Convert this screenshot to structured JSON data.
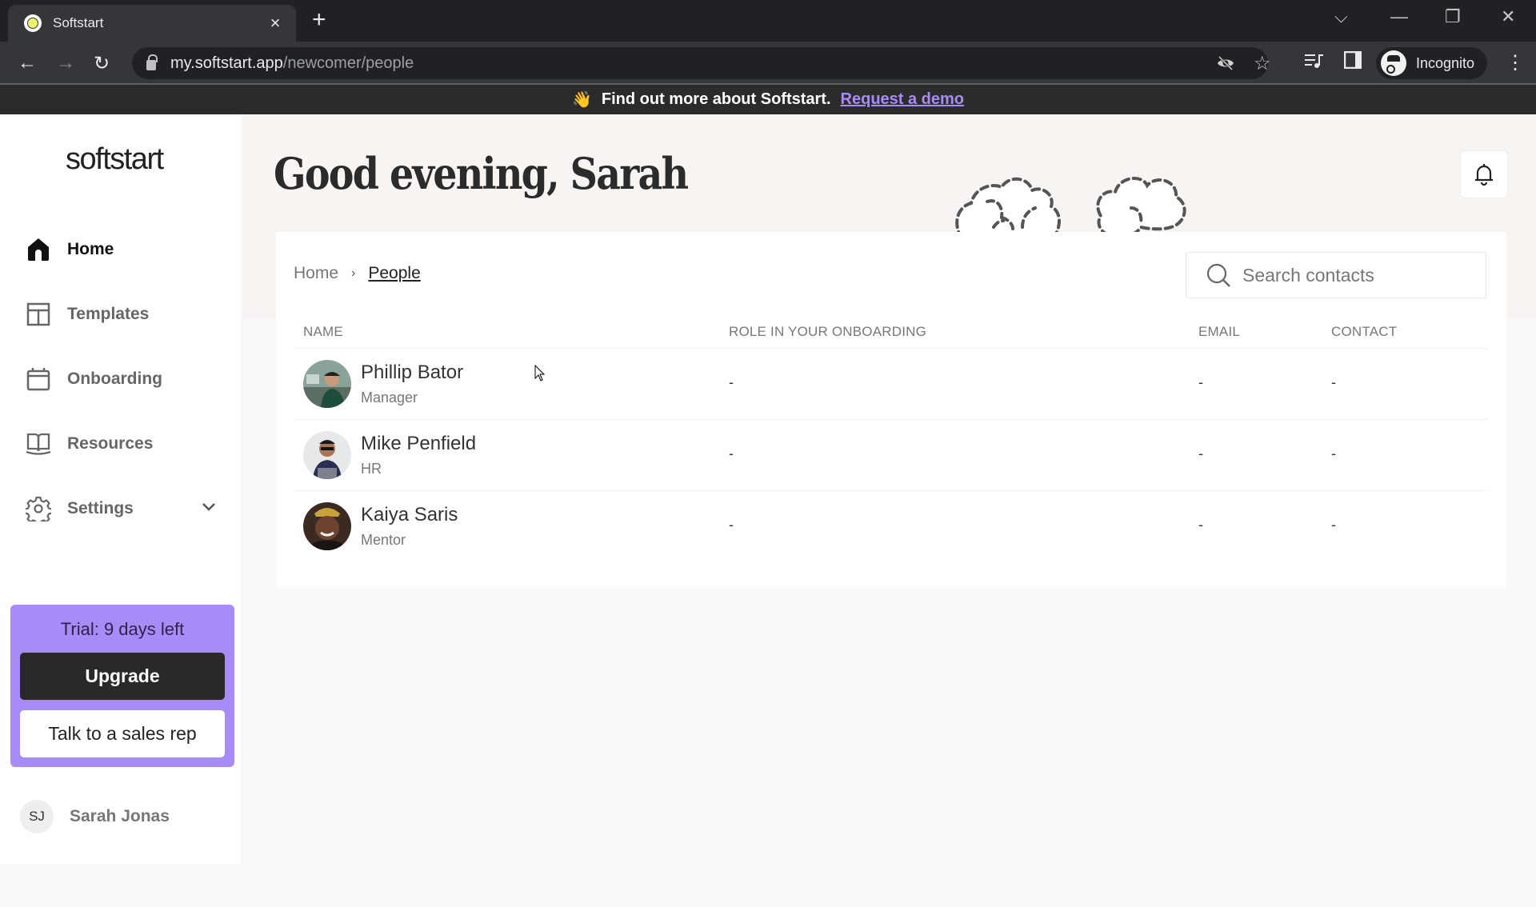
{
  "browser": {
    "tab_title": "Softstart",
    "url_host": "my.softstart.app",
    "url_path": "/newcomer/people",
    "profile_label": "Incognito"
  },
  "banner": {
    "emoji": "👋",
    "text": "Find out more about Softstart.",
    "link": "Request a demo"
  },
  "sidebar": {
    "logo": "softstart",
    "items": [
      {
        "label": "Home",
        "icon": "home-icon",
        "active": true
      },
      {
        "label": "Templates",
        "icon": "templates-icon"
      },
      {
        "label": "Onboarding",
        "icon": "calendar-icon"
      },
      {
        "label": "Resources",
        "icon": "book-icon"
      },
      {
        "label": "Settings",
        "icon": "gear-icon",
        "expandable": true
      }
    ],
    "trial": {
      "text": "Trial: 9 days left",
      "upgrade_label": "Upgrade",
      "sales_label": "Talk to a sales rep"
    },
    "user": {
      "initials": "SJ",
      "name": "Sarah Jonas"
    }
  },
  "main": {
    "greeting": "Good evening, Sarah",
    "breadcrumb": {
      "home": "Home",
      "separator": "›",
      "current": "People"
    },
    "search": {
      "placeholder": "Search contacts",
      "value": ""
    },
    "table": {
      "columns": [
        "NAME",
        "ROLE IN YOUR ONBOARDING",
        "EMAIL",
        "CONTACT"
      ],
      "rows": [
        {
          "name": "Phillip Bator",
          "role": "Manager",
          "onboarding_role": "-",
          "email": "-",
          "contact": "-"
        },
        {
          "name": "Mike Penfield",
          "role": "HR",
          "onboarding_role": "-",
          "email": "-",
          "contact": "-"
        },
        {
          "name": "Kaiya Saris",
          "role": "Mentor",
          "onboarding_role": "-",
          "email": "-",
          "contact": "-"
        }
      ]
    }
  },
  "colors": {
    "accent": "#a78bf7",
    "link": "#a98bf5",
    "dark": "#2b2829",
    "hero_bg": "#f7f4f1"
  }
}
